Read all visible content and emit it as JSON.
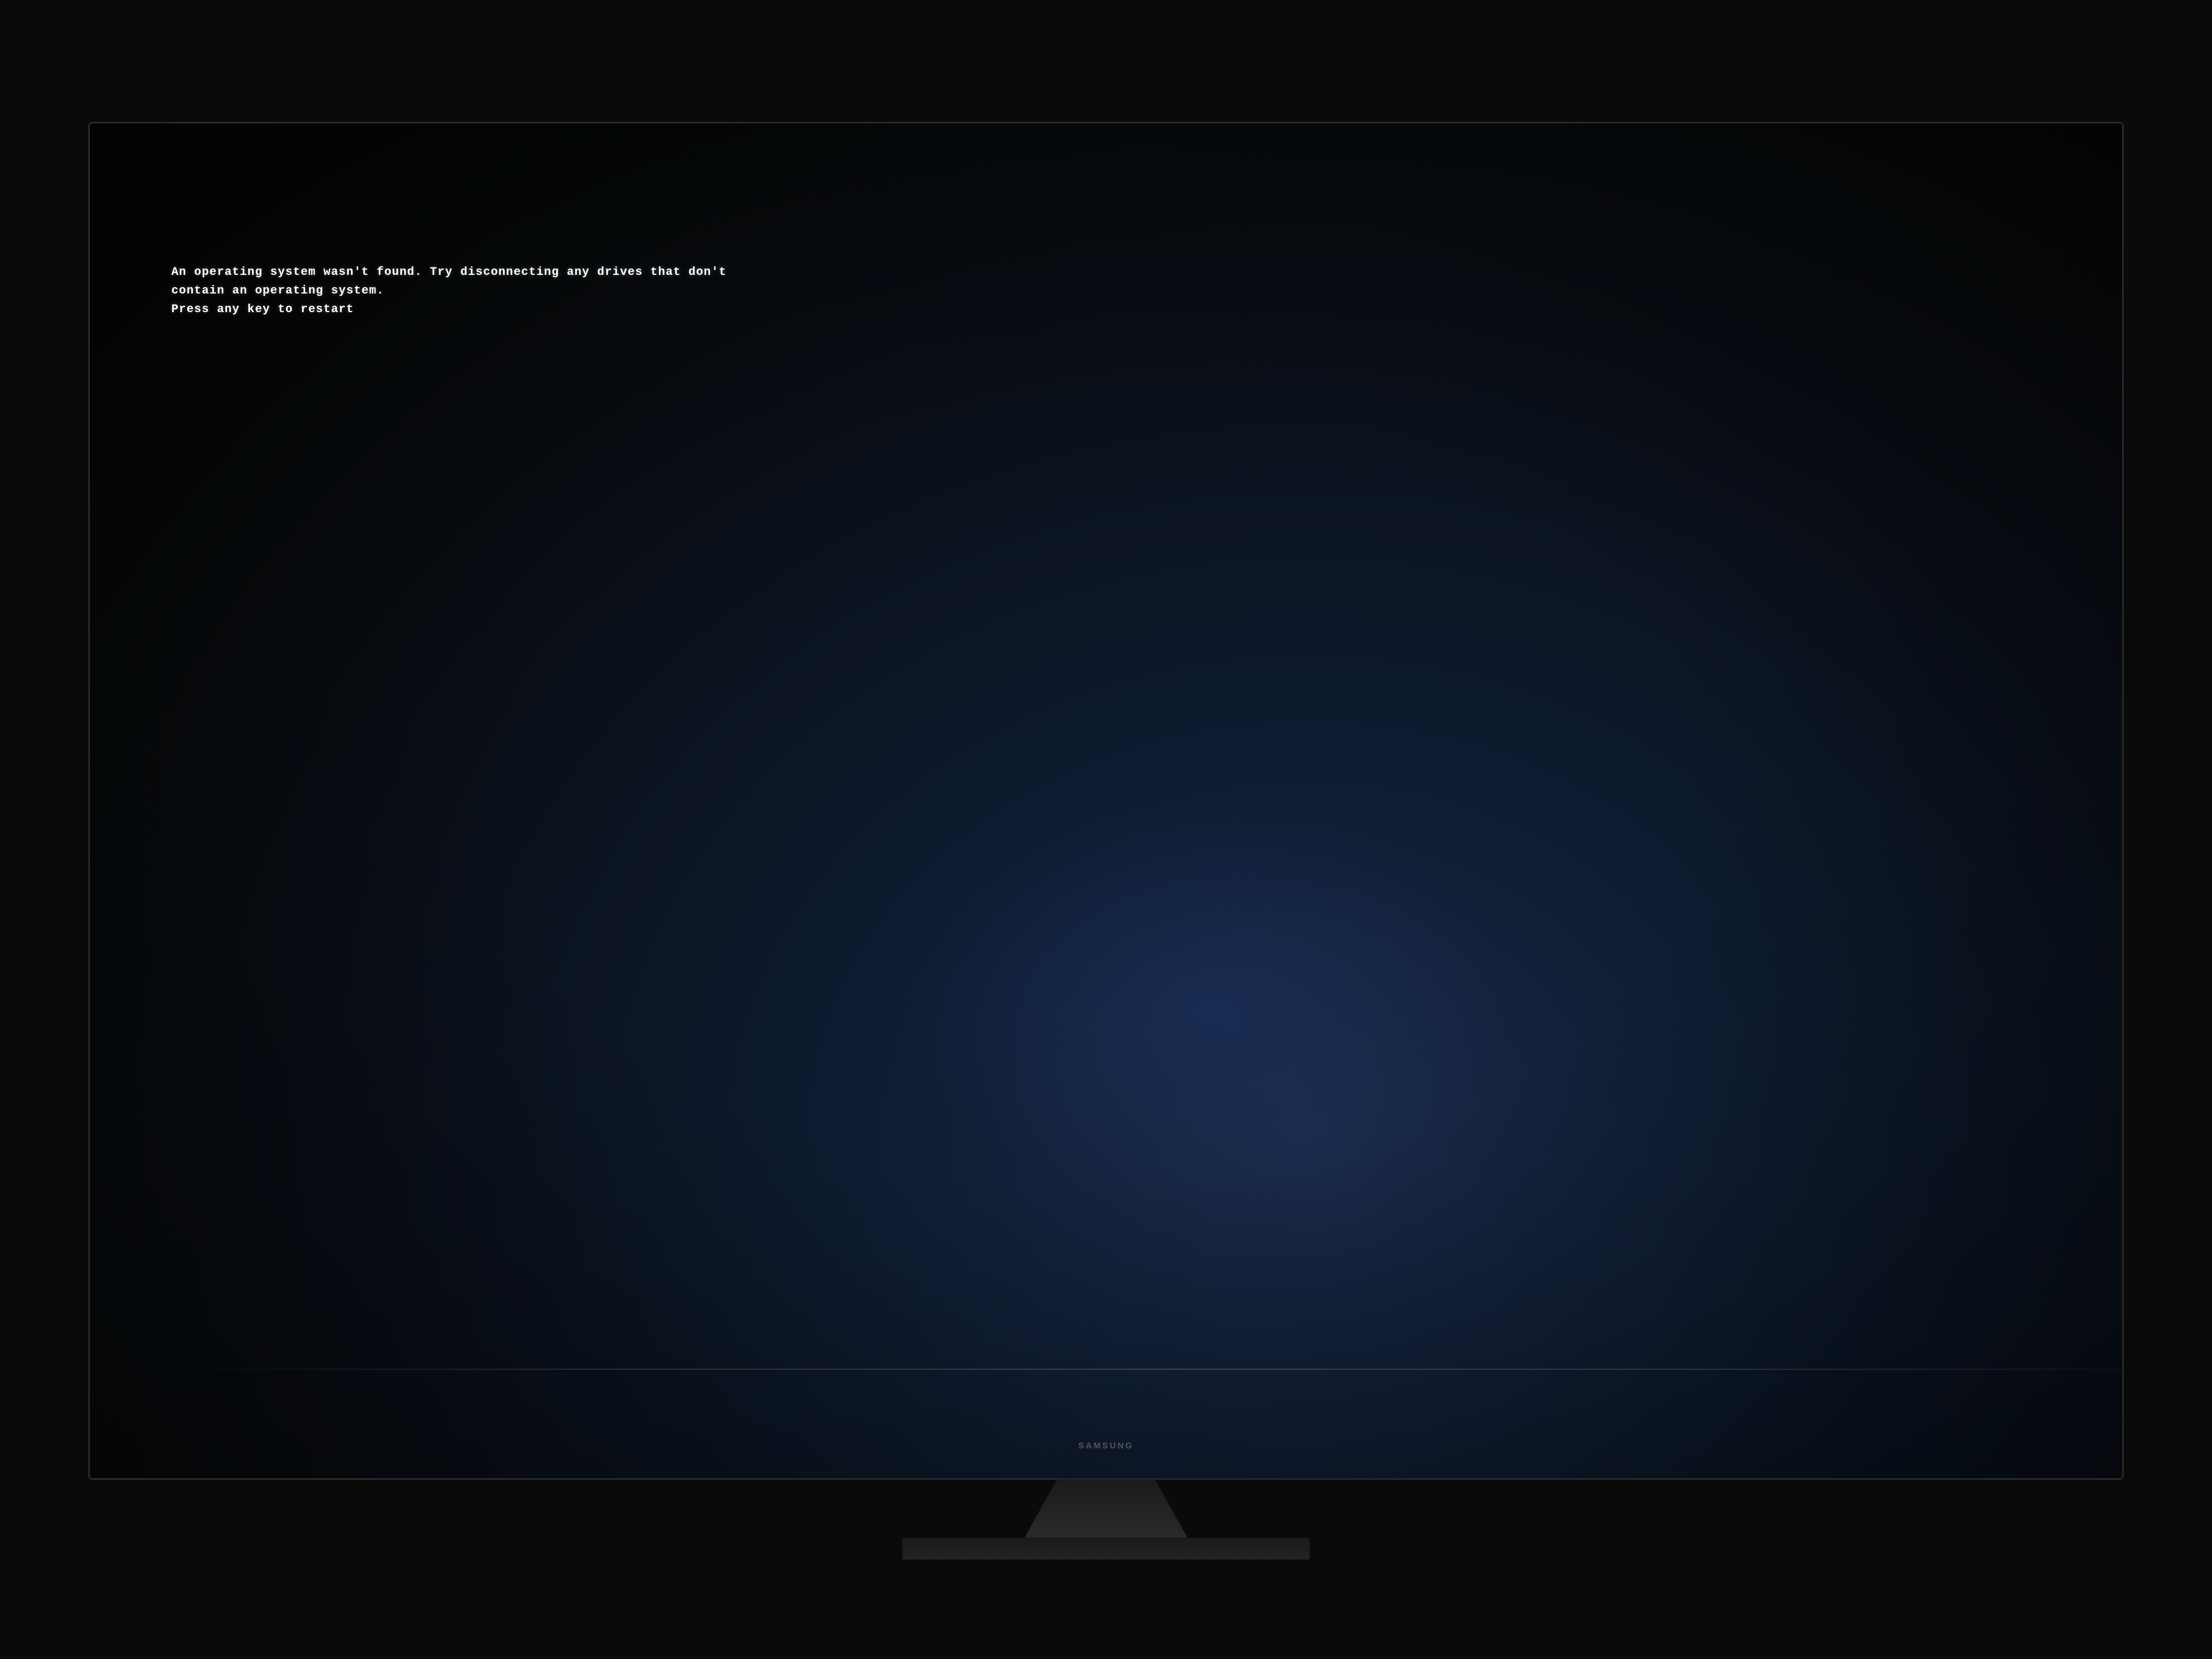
{
  "screen": {
    "background_color": "#080c14",
    "error_messages": {
      "line1": "An operating system wasn't found. Try disconnecting any drives that don't",
      "line2": "contain an operating system.",
      "line3": "Press any key to restart"
    }
  },
  "monitor": {
    "brand": "SAMSUNG",
    "stand_color": "#1a1a1a",
    "base_color": "#222222"
  }
}
